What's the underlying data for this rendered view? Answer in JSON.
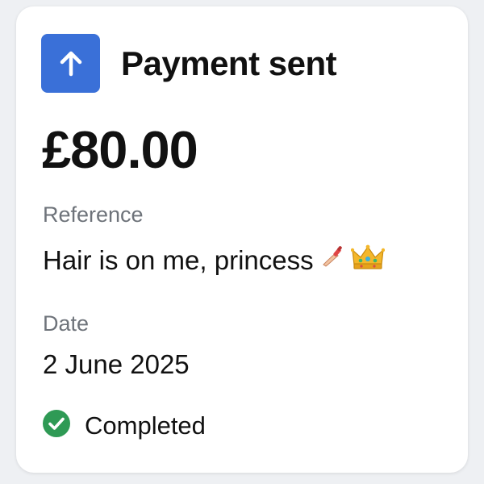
{
  "header": {
    "icon": "arrow-up-icon",
    "title": "Payment sent",
    "accent_color": "#3a70d8"
  },
  "amount": "£80.00",
  "reference": {
    "label": "Reference",
    "value": "Hair is on me, princess",
    "emoji_icons": [
      "nail-polish-icon",
      "crown-icon"
    ]
  },
  "date": {
    "label": "Date",
    "value": "2 June 2025"
  },
  "status": {
    "icon": "check-circle-icon",
    "text": "Completed",
    "color": "#2f9a55"
  }
}
